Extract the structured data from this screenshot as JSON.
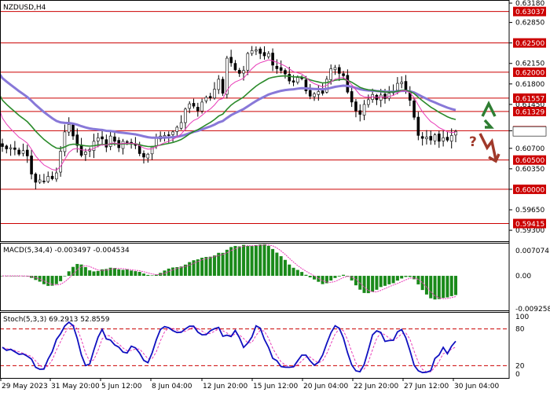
{
  "chart_data": {
    "type": "candlestick",
    "symbol_label": "NZDUSD,H4",
    "price_pane": {
      "axis_ticks": [
        "0.63180",
        "0.62850",
        "0.62500",
        "0.62150",
        "0.61800",
        "0.61450",
        "0.61000",
        "0.60700",
        "0.60350",
        "0.60000",
        "0.59650",
        "0.59300"
      ],
      "levels": [
        {
          "label": "0.63037",
          "value": 0.63037
        },
        {
          "label": "0.62500",
          "value": 0.625
        },
        {
          "label": "0.62000",
          "value": 0.62
        },
        {
          "label": "0.61557",
          "value": 0.61557
        },
        {
          "label": "0.61329",
          "value": 0.61329
        },
        {
          "label": "0.61000",
          "value": 0.61
        },
        {
          "label": "0.60500",
          "value": 0.605
        },
        {
          "label": "0.60000",
          "value": 0.6
        },
        {
          "label": "0.59415",
          "value": 0.59415
        }
      ],
      "ylim": [
        0.5913,
        0.6323
      ],
      "closes": [
        0.6073,
        0.6069,
        0.6071,
        0.6068,
        0.606,
        0.6066,
        0.6057,
        0.6026,
        0.6012,
        0.6016,
        0.6013,
        0.6022,
        0.6018,
        0.6028,
        0.6065,
        0.6098,
        0.6111,
        0.6091,
        0.6075,
        0.6058,
        0.6064,
        0.6068,
        0.6082,
        0.6088,
        0.6086,
        0.6072,
        0.6091,
        0.6082,
        0.6071,
        0.6082,
        0.608,
        0.6078,
        0.6075,
        0.6061,
        0.6055,
        0.606,
        0.6072,
        0.6087,
        0.6091,
        0.6092,
        0.6092,
        0.6098,
        0.6106,
        0.6114,
        0.6137,
        0.6146,
        0.6142,
        0.6134,
        0.6149,
        0.6157,
        0.6156,
        0.6171,
        0.6188,
        0.6164,
        0.6224,
        0.6216,
        0.6204,
        0.6198,
        0.6203,
        0.6232,
        0.6237,
        0.6238,
        0.6232,
        0.6228,
        0.6232,
        0.6212,
        0.6206,
        0.6203,
        0.6197,
        0.6185,
        0.6183,
        0.6191,
        0.6189,
        0.6168,
        0.6159,
        0.6163,
        0.6167,
        0.6164,
        0.6188,
        0.6206,
        0.6208,
        0.6198,
        0.6194,
        0.6166,
        0.6149,
        0.6134,
        0.6128,
        0.6145,
        0.6153,
        0.6162,
        0.6153,
        0.6161,
        0.6155,
        0.6164,
        0.6168,
        0.6181,
        0.6183,
        0.6168,
        0.6152,
        0.6123,
        0.6092,
        0.6087,
        0.6089,
        0.6084,
        0.6093,
        0.6082,
        0.6088,
        0.6084,
        0.6092,
        0.6099
      ],
      "ma_slow": {
        "start": 0.6196,
        "end": 0.614
      },
      "ma_mid": {
        "start": 0.616,
        "end": 0.6134
      },
      "ma_fast": {
        "start": 0.6134,
        "end": 0.613
      },
      "colors": {
        "slow": "#8878d8",
        "mid": "#2a8a2a",
        "fast": "#e83cb8",
        "level": "#cc0000",
        "candle": "#000000",
        "current_price": "#ffffff"
      },
      "arrows": {
        "up": "#2e7d32",
        "down": "#a0392a",
        "question_mark": "?"
      }
    },
    "macd_pane": {
      "label": "MACD(5,34,4) -0.003497 -0.004534",
      "axis_ticks": [
        "0.007074",
        "0.00",
        "-0.009258"
      ],
      "ylim": [
        -0.009258,
        0.007074
      ],
      "bar_color": "#1a8a1a",
      "signal_color": "#e83cb8"
    },
    "stoch_pane": {
      "label": "Stoch(5,3,3) 69.2913 52.8559",
      "axis_ticks": [
        "100",
        "80",
        "20",
        "0"
      ],
      "levels": [
        80,
        20
      ],
      "ylim": [
        0,
        100
      ],
      "main_color": "#1010c0",
      "signal_color": "#e83cb8",
      "level_color": "#cc0000"
    },
    "x_axis_ticks": [
      "29 May 2023",
      "31 May 20:00",
      "5 Jun 12:00",
      "8 Jun 04:00",
      "12 Jun 20:00",
      "15 Jun 12:00",
      "20 Jun 04:00",
      "22 Jun 20:00",
      "27 Jun 12:00",
      "30 Jun 04:00"
    ]
  }
}
